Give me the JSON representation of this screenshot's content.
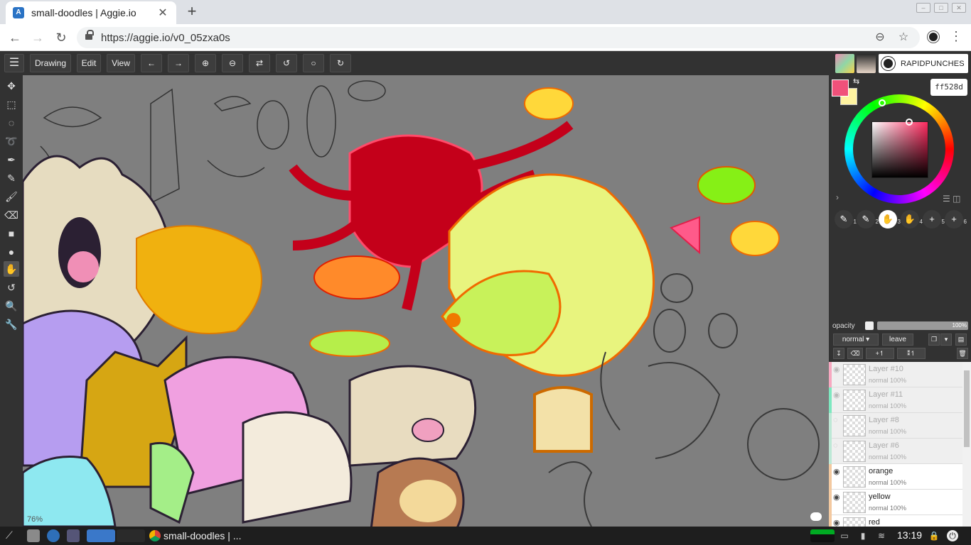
{
  "browser": {
    "tab_title": "small-doodles | Aggie.io",
    "tab_close": "✕",
    "new_tab": "+",
    "url": "https://aggie.io/v0_05zxa0s",
    "back": "←",
    "forward": "→",
    "reload": "↻"
  },
  "app": {
    "menu_drawing": "Drawing",
    "menu_edit": "Edit",
    "menu_view": "View",
    "undo": "←",
    "redo": "→",
    "zoom_in": "⊕",
    "zoom_out": "⊖",
    "flip": "⇄",
    "rotate_left": "↺",
    "rotate_reset": "○",
    "rotate_right": "↻",
    "username": "RAPIDPUNCHES",
    "zoom_level": "76%"
  },
  "color": {
    "hex": "ff528d",
    "primary": "#f0517a",
    "secondary": "#fff3a0"
  },
  "brushes": [
    {
      "num": "1",
      "icon": "brush-icon"
    },
    {
      "num": "2",
      "icon": "brush-icon"
    },
    {
      "num": "3",
      "icon": "hand-icon"
    },
    {
      "num": "4",
      "icon": "hand-icon"
    },
    {
      "num": "5",
      "icon": "plus-icon"
    },
    {
      "num": "6",
      "icon": "plus-icon"
    }
  ],
  "layer_controls": {
    "opacity_label": "opacity",
    "opacity_value": "100%",
    "blend_mode": "normal ▾",
    "leave": "leave"
  },
  "layers": [
    {
      "name": "Layer #10",
      "mode": "normal 100%",
      "dim": true
    },
    {
      "name": "Layer #11",
      "mode": "normal 100%",
      "dim": true
    },
    {
      "name": "Layer #8",
      "mode": "normal 100%",
      "dim": true
    },
    {
      "name": "Layer #6",
      "mode": "normal 100%",
      "dim": true
    },
    {
      "name": "orange",
      "mode": "normal 100%",
      "dim": false
    },
    {
      "name": "yellow",
      "mode": "normal 100%",
      "dim": false
    },
    {
      "name": "red",
      "mode": "",
      "dim": false
    }
  ],
  "taskbar": {
    "app_label": "small-doodles | ...",
    "clock": "13:19"
  }
}
